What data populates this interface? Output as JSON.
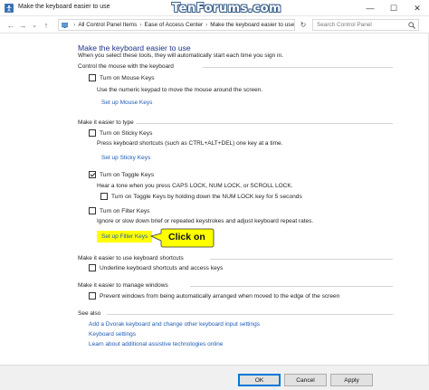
{
  "window": {
    "title": "Make the keyboard easier to use",
    "watermark": "TenForums.com",
    "minimize_glyph": "—",
    "maximize_glyph": "☐",
    "close_glyph": "✕"
  },
  "address_bar": {
    "back_glyph": "←",
    "forward_glyph": "→",
    "recent_glyph": "⌄",
    "up_glyph": "↑",
    "breadcrumb": [
      "All Control Panel Items",
      "Ease of Access Center",
      "Make the keyboard easier to use"
    ],
    "separator": "›",
    "refresh_glyph": "↻",
    "search_placeholder": "Search Control Panel"
  },
  "page": {
    "heading": "Make the keyboard easier to use",
    "subheading": "When you select these tools, they will automatically start each time you sign in."
  },
  "sections": {
    "mouse": {
      "title": "Control the mouse with the keyboard",
      "mouse_keys_label": "Turn on Mouse Keys",
      "mouse_keys_checked": false,
      "mouse_keys_desc": "Use the numeric keypad to move the mouse around the screen.",
      "mouse_keys_link": "Set up Mouse Keys"
    },
    "typing": {
      "title": "Make it easier to type",
      "sticky_label": "Turn on Sticky Keys",
      "sticky_checked": false,
      "sticky_desc": "Press keyboard shortcuts (such as CTRL+ALT+DEL) one key at a time.",
      "sticky_link": "Set up Sticky Keys",
      "toggle_label": "Turn on Toggle Keys",
      "toggle_checked": true,
      "toggle_desc": "Hear a tone when you press CAPS LOCK, NUM LOCK, or SCROLL LOCK.",
      "toggle_hold_label": "Turn on Toggle Keys by holding down the NUM LOCK key for 5 seconds",
      "toggle_hold_checked": false,
      "filter_label": "Turn on Filter Keys",
      "filter_checked": false,
      "filter_desc": "Ignore or slow down brief or repeated keystrokes and adjust keyboard repeat rates.",
      "filter_link": "Set up Filter Keys"
    },
    "shortcuts": {
      "title": "Make it easier to use keyboard shortcuts",
      "underline_label": "Underline keyboard shortcuts and access keys",
      "underline_checked": false
    },
    "windows": {
      "title": "Make it easier to manage windows",
      "arrange_label": "Prevent windows from being automatically arranged when moved to the edge of the screen",
      "arrange_checked": false
    },
    "see_also": {
      "title": "See also",
      "links": [
        "Add a Dvorak keyboard and change other keyboard input settings",
        "Keyboard settings",
        "Learn about additional assistive technologies online"
      ]
    }
  },
  "callout": {
    "text": "Click on",
    "color": "#ffff00"
  },
  "buttons": {
    "ok": "OK",
    "cancel": "Cancel",
    "apply": "Apply"
  },
  "colors": {
    "link": "#1e5bb4",
    "heading": "#1e3287",
    "highlight": "#ffff00"
  }
}
